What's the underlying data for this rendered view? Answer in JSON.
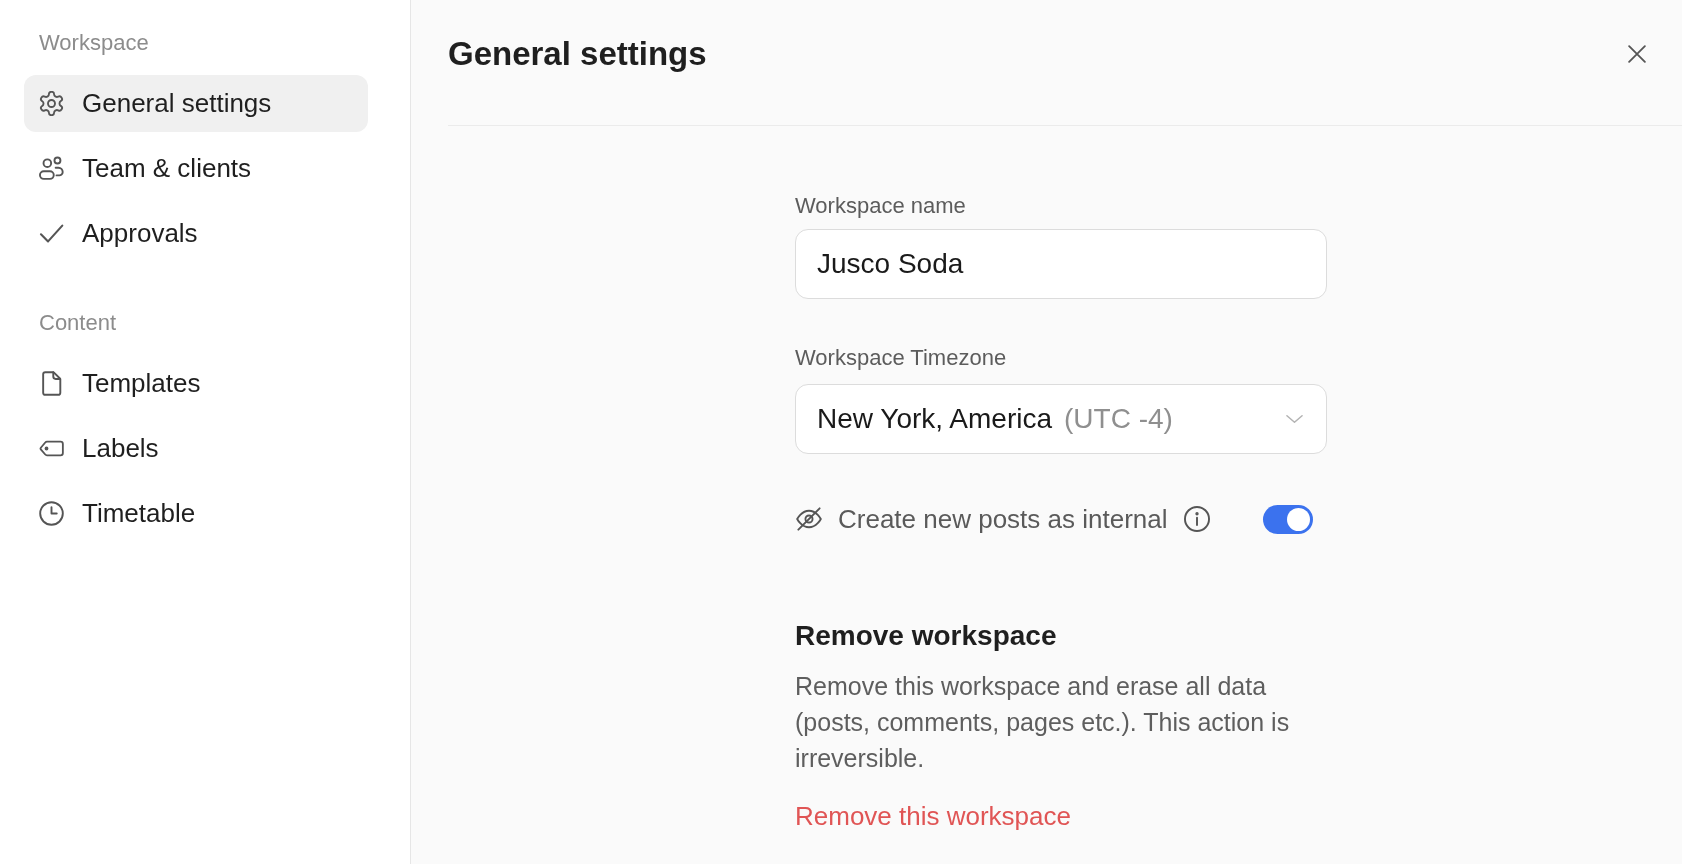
{
  "sidebar": {
    "sections": [
      {
        "heading": "Workspace",
        "items": [
          {
            "label": "General settings",
            "selected": true
          },
          {
            "label": "Team & clients",
            "selected": false
          },
          {
            "label": "Approvals",
            "selected": false
          }
        ]
      },
      {
        "heading": "Content",
        "items": [
          {
            "label": "Templates",
            "selected": false
          },
          {
            "label": "Labels",
            "selected": false
          },
          {
            "label": "Timetable",
            "selected": false
          }
        ]
      }
    ]
  },
  "header": {
    "title": "General settings"
  },
  "form": {
    "workspace_name": {
      "label": "Workspace name",
      "value": "Jusco Soda"
    },
    "timezone": {
      "label": "Workspace Timezone",
      "value": "New York, America",
      "offset": "(UTC -4)"
    },
    "internal_toggle": {
      "label": "Create new posts as internal",
      "on": true
    }
  },
  "remove_section": {
    "title": "Remove workspace",
    "description": "Remove this workspace and erase all data (posts, comments, pages etc.). This action is irreversible.",
    "link": "Remove this workspace"
  }
}
